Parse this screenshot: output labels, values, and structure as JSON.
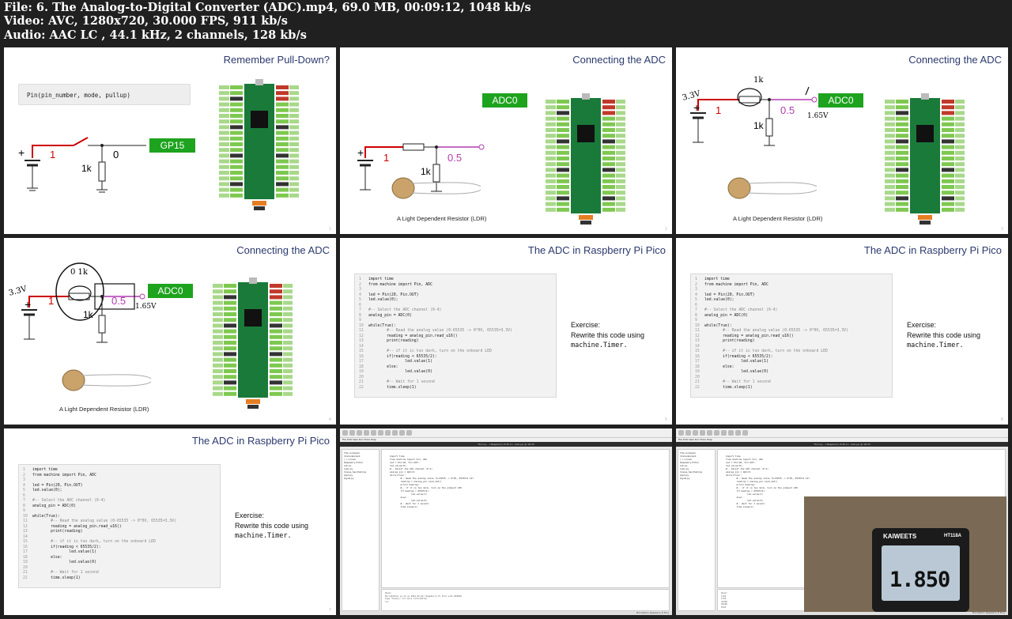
{
  "header": {
    "line1": "File: 6. The Analog-to-Digital Converter (ADC).mp4, 69.0 MB, 00:09:12, 1048 kb/s",
    "line2": "Video: AVC, 1280x720, 30.000 FPS, 911 kb/s",
    "line3": "Audio: AAC LC , 44.1 kHz, 2 channels, 128 kb/s"
  },
  "slides": {
    "s1": {
      "title": "Remember Pull-Down?",
      "code": "Pin(pin_number, mode, pullup)",
      "v1": "1",
      "v0": "0",
      "res": "1k",
      "pin": "GP15",
      "plus": "+"
    },
    "s2": {
      "title": "Connecting the ADC",
      "v1": "1",
      "vmid": "0.5",
      "res": "1k",
      "pin": "ADC0",
      "plus": "+",
      "ldr": "A Light Dependent Resistor (LDR)"
    },
    "s3": {
      "title": "Connecting the ADC",
      "v1": "1",
      "vmid": "0.5",
      "res": "1k",
      "pin": "ADC0",
      "plus": "+",
      "hw_volt": "3.3V",
      "hw_mid": "1.65V",
      "hw_k": "1k"
    },
    "s4": {
      "title": "Connecting the ADC",
      "v1": "1",
      "vmid": "0.5",
      "res": "1k",
      "pin": "ADC0",
      "plus": "+",
      "hw_volt": "3.3V",
      "hw_mid": "1.65V",
      "hw_ok": "0  1k",
      "ldr": "A Light Dependent Resistor (LDR)"
    },
    "s5": {
      "title": "The ADC in Raspberry Pi Pico"
    },
    "s6": {
      "title": "The ADC in Raspberry Pi Pico"
    },
    "s7": {
      "title": "The ADC in Raspberry Pi Pico"
    }
  },
  "exercise": {
    "l1": "Exercise:",
    "l2": "Rewrite this code using",
    "l3": "machine.Timer."
  },
  "code_lines": [
    "import time",
    "from machine import Pin, ADC",
    "",
    "led = Pin(20, Pin.OUT)",
    "led.value(0);",
    "",
    "#-- Select the ADC channel (0-4)",
    "analog_pin = ADC(0)",
    "",
    "while(True):",
    "        #-- Read the analog value (0-65535 -> 0*0V, 65535=3.3V)",
    "        reading = analog_pin.read_u16()",
    "        print(reading)",
    "",
    "        #-- if it is too dark, turn on the onboard LED",
    "        if(reading < 65535/2):",
    "                led.value(1)",
    "        else:",
    "                led.value(0)",
    "",
    "        #-- Wait for 1 second",
    "        time.sleep(1)"
  ],
  "ide": {
    "title": "Thonny - <Raspberry Pi Pico> :/adc.py @ 18:15",
    "menu": "File  Edit  View  Run  Tools  Help",
    "files": [
      "This computer",
      "/home/student",
      "/ :/: course",
      "",
      "Raspberry Pi Pico",
      "adc.py",
      "main.py",
      "mouse_handheld.py",
      "pwm.py",
      "signal.py"
    ],
    "shell_label": "Shell",
    "status": "MicroPython (Raspberry Pi Pico)",
    "shell_lines": [
      "MicroPython v1.14 on 2021-02-02; Raspberry Pi Pico with RP2040",
      "Type \"help()\" for more information.",
      ">>>"
    ],
    "shell_values": [
      "1116",
      "1734",
      "32768",
      "25100",
      "1033"
    ]
  },
  "meter": {
    "brand": "KAIWEETS",
    "model": "HT118A",
    "reading": "1.850"
  }
}
